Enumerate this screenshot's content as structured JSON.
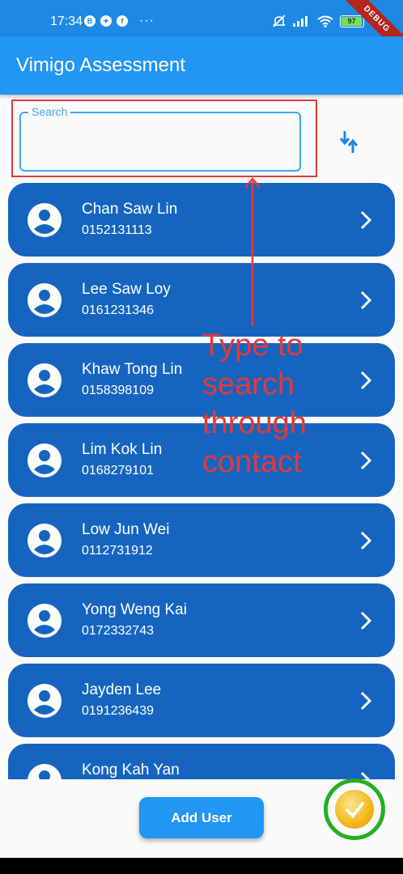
{
  "status_bar": {
    "time": "17:34",
    "battery": "97",
    "debug_label": "DEBUG",
    "left_icons": [
      "b-icon",
      "pinwheel-icon",
      "facebook-icon"
    ]
  },
  "app_bar": {
    "title": "Vimigo Assessment"
  },
  "search": {
    "label": "Search",
    "value": ""
  },
  "contacts": [
    {
      "name": "Chan Saw Lin",
      "phone": "0152131113"
    },
    {
      "name": "Lee Saw Loy",
      "phone": "0161231346"
    },
    {
      "name": "Khaw Tong Lin",
      "phone": "0158398109"
    },
    {
      "name": "Lim Kok Lin",
      "phone": "0168279101"
    },
    {
      "name": "Low Jun Wei",
      "phone": "0112731912"
    },
    {
      "name": "Yong Weng Kai",
      "phone": "0172332743"
    },
    {
      "name": "Jayden Lee",
      "phone": "0191236439"
    },
    {
      "name": "Kong Kah Yan",
      "phone": ""
    }
  ],
  "annotation": {
    "lines": [
      "Type to",
      "search",
      "through",
      "contact"
    ]
  },
  "actions": {
    "add_user_label": "Add User"
  },
  "colors": {
    "status_bar": "#1e88e5",
    "app_bar": "#2196f3",
    "card": "#1565c0",
    "annotation": "#e53935",
    "fab_ring": "#22b022"
  }
}
